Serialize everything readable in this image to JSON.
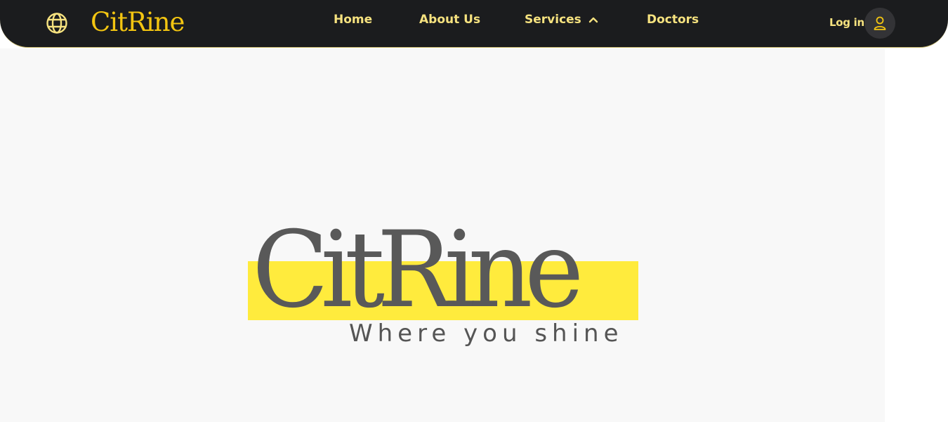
{
  "header": {
    "brand": "CitRine",
    "nav": [
      {
        "label": "Home"
      },
      {
        "label": "About Us"
      },
      {
        "label": "Services"
      },
      {
        "label": "Doctors"
      }
    ],
    "login_label": "Log in",
    "icons": {
      "language": "globe-icon",
      "services_toggle": "chevron-up-icon",
      "account": "user-icon"
    }
  },
  "hero": {
    "logo_word": "CitRine",
    "tagline": "Where you shine"
  },
  "colors": {
    "navbar_bg": "#1b1c1e",
    "brand_yellow": "#f3c511",
    "nav_text": "#f6e27f",
    "logo_band": "#ffeb3d",
    "logo_text": "#595959",
    "hero_bg": "#f8f8f8"
  }
}
